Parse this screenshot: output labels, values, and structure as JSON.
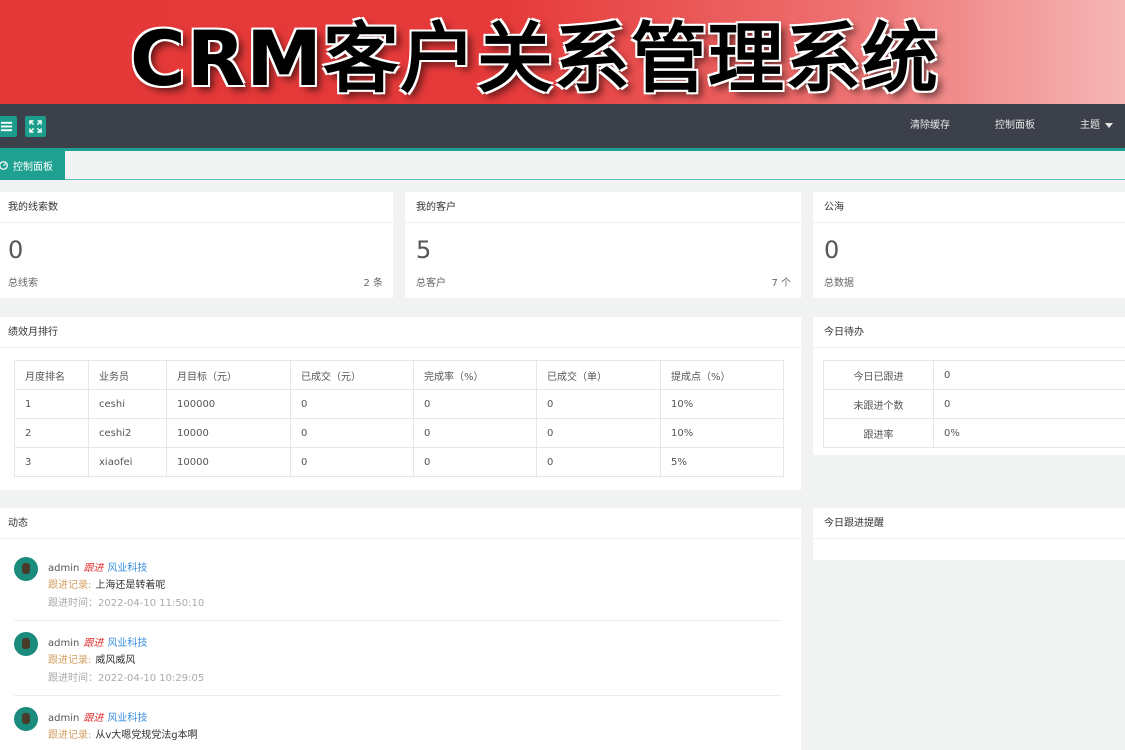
{
  "banner": {
    "title": "CRM客户关系管理系统"
  },
  "topnav": {
    "clear_cache": "清除缓存",
    "dashboard": "控制面板",
    "theme": "主题"
  },
  "tabs": {
    "active_label": "控制面板"
  },
  "stats": [
    {
      "title": "我的线索数",
      "value": "0",
      "label": "总线索",
      "count": "2 条"
    },
    {
      "title": "我的客户",
      "value": "5",
      "label": "总客户",
      "count": "7 个"
    },
    {
      "title": "公海",
      "value": "0",
      "label": "总数据",
      "count": ""
    }
  ],
  "performance": {
    "title": "绩效月排行",
    "columns": [
      "月度排名",
      "业务员",
      "月目标（元）",
      "已成交（元）",
      "完成率（%）",
      "已成交（单）",
      "提成点（%）"
    ],
    "rows": [
      [
        "1",
        "ceshi",
        "100000",
        "0",
        "0",
        "0",
        "10%"
      ],
      [
        "2",
        "ceshi2",
        "10000",
        "0",
        "0",
        "0",
        "10%"
      ],
      [
        "3",
        "xiaofei",
        "10000",
        "0",
        "0",
        "0",
        "5%"
      ]
    ]
  },
  "todo": {
    "title": "今日待办",
    "rows": [
      [
        "今日已跟进",
        "0"
      ],
      [
        "未跟进个数",
        "0"
      ],
      [
        "跟进率",
        "0%"
      ]
    ]
  },
  "activity": {
    "title": "动态",
    "items": [
      {
        "user": "admin",
        "type": "跟进",
        "company": "风业科技",
        "record_label": "跟进记录:",
        "record": "上海还是转着呢",
        "time": "跟进时间：2022-04-10 11:50:10"
      },
      {
        "user": "admin",
        "type": "跟进",
        "company": "风业科技",
        "record_label": "跟进记录:",
        "record": "威风威风",
        "time": "跟进时间：2022-04-10 10:29:05"
      },
      {
        "user": "admin",
        "type": "跟进",
        "company": "风业科技",
        "record_label": "跟进记录:",
        "record": "从v大嗯党规党法g本啊",
        "time": ""
      }
    ]
  },
  "reminder": {
    "title": "今日跟进提醒"
  },
  "colors": {
    "accent": "#1fa191",
    "nav": "#3c404a",
    "banner": "#e53838"
  }
}
